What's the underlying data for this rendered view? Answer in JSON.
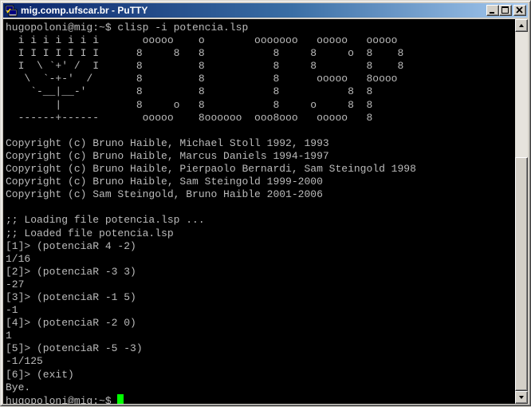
{
  "window": {
    "title": "mig.comp.ufscar.br - PuTTY",
    "app_icon": "putty-icon",
    "buttons": {
      "minimize": "minimize-icon",
      "maximize": "maximize-icon",
      "close": "close-icon"
    },
    "colors": {
      "titlebar_start": "#0a246a",
      "titlebar_end": "#a6caf0",
      "terminal_bg": "#000000",
      "terminal_fg": "#bbbbbb",
      "cursor": "#00ff00"
    }
  },
  "terminal": {
    "lines": [
      "hugopoloni@mig:~$ clisp -i potencia.lsp",
      "  i i i i i i i       ooooo    o        ooooooo   ooooo   ooooo",
      "  I I I I I I I      8     8   8           8     8     o  8    8",
      "  I  \\ `+' /  I      8         8           8     8        8    8",
      "   \\  `-+-'  /       8         8           8      ooooo   8oooo",
      "    `-__|__-'        8         8           8           8  8",
      "        |            8     o   8           8     o     8  8",
      "  ------+------       ooooo    8oooooo  ooo8ooo   ooooo   8",
      "",
      "Copyright (c) Bruno Haible, Michael Stoll 1992, 1993",
      "Copyright (c) Bruno Haible, Marcus Daniels 1994-1997",
      "Copyright (c) Bruno Haible, Pierpaolo Bernardi, Sam Steingold 1998",
      "Copyright (c) Bruno Haible, Sam Steingold 1999-2000",
      "Copyright (c) Sam Steingold, Bruno Haible 2001-2006",
      "",
      ";; Loading file potencia.lsp ...",
      ";; Loaded file potencia.lsp",
      "[1]> (potenciaR 4 -2)",
      "1/16",
      "[2]> (potenciaR -3 3)",
      "-27",
      "[3]> (potenciaR -1 5)",
      "-1",
      "[4]> (potenciaR -2 0)",
      "1",
      "[5]> (potenciaR -5 -3)",
      "-1/125",
      "[6]> (exit)",
      "Bye."
    ],
    "prompt": "hugopoloni@mig:~$ "
  }
}
